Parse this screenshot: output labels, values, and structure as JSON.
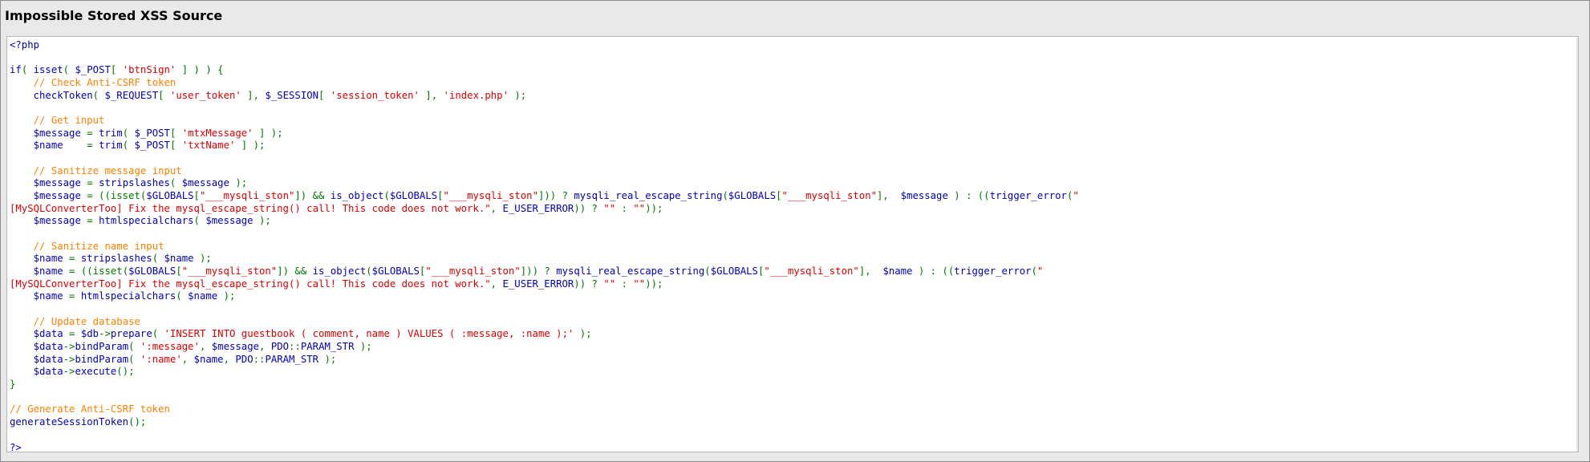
{
  "title": "Impossible Stored XSS Source",
  "code_lines": [
    [
      [
        "def",
        "<?php"
      ]
    ],
    [],
    [
      [
        "def",
        "if"
      ],
      [
        "kw",
        "( "
      ],
      [
        "def",
        "isset"
      ],
      [
        "kw",
        "( "
      ],
      [
        "def",
        "$_POST"
      ],
      [
        "kw",
        "[ "
      ],
      [
        "str",
        "'btnSign'"
      ],
      [
        "kw",
        " ] ) ) {"
      ]
    ],
    [
      [
        "kw",
        "    "
      ],
      [
        "com",
        "// Check Anti-CSRF token"
      ]
    ],
    [
      [
        "kw",
        "    "
      ],
      [
        "def",
        "checkToken"
      ],
      [
        "kw",
        "( "
      ],
      [
        "def",
        "$_REQUEST"
      ],
      [
        "kw",
        "[ "
      ],
      [
        "str",
        "'user_token'"
      ],
      [
        "kw",
        " ], "
      ],
      [
        "def",
        "$_SESSION"
      ],
      [
        "kw",
        "[ "
      ],
      [
        "str",
        "'session_token'"
      ],
      [
        "kw",
        " ], "
      ],
      [
        "str",
        "'index.php'"
      ],
      [
        "kw",
        " );"
      ]
    ],
    [],
    [
      [
        "kw",
        "    "
      ],
      [
        "com",
        "// Get input"
      ]
    ],
    [
      [
        "kw",
        "    "
      ],
      [
        "def",
        "$message"
      ],
      [
        "kw",
        " = "
      ],
      [
        "def",
        "trim"
      ],
      [
        "kw",
        "( "
      ],
      [
        "def",
        "$_POST"
      ],
      [
        "kw",
        "[ "
      ],
      [
        "str",
        "'mtxMessage'"
      ],
      [
        "kw",
        " ] );"
      ]
    ],
    [
      [
        "kw",
        "    "
      ],
      [
        "def",
        "$name"
      ],
      [
        "kw",
        "    = "
      ],
      [
        "def",
        "trim"
      ],
      [
        "kw",
        "( "
      ],
      [
        "def",
        "$_POST"
      ],
      [
        "kw",
        "[ "
      ],
      [
        "str",
        "'txtName'"
      ],
      [
        "kw",
        " ] );"
      ]
    ],
    [],
    [
      [
        "kw",
        "    "
      ],
      [
        "com",
        "// Sanitize message input"
      ]
    ],
    [
      [
        "kw",
        "    "
      ],
      [
        "def",
        "$message"
      ],
      [
        "kw",
        " = "
      ],
      [
        "def",
        "stripslashes"
      ],
      [
        "kw",
        "( "
      ],
      [
        "def",
        "$message"
      ],
      [
        "kw",
        " );"
      ]
    ],
    [
      [
        "kw",
        "    "
      ],
      [
        "def",
        "$message"
      ],
      [
        "kw",
        " = ((isset("
      ],
      [
        "def",
        "$GLOBALS"
      ],
      [
        "kw",
        "["
      ],
      [
        "str",
        "\"___mysqli_ston\""
      ],
      [
        "kw",
        "]) && "
      ],
      [
        "def",
        "is_object"
      ],
      [
        "kw",
        "("
      ],
      [
        "def",
        "$GLOBALS"
      ],
      [
        "kw",
        "["
      ],
      [
        "str",
        "\"___mysqli_ston\""
      ],
      [
        "kw",
        "])) ? "
      ],
      [
        "def",
        "mysqli_real_escape_string"
      ],
      [
        "kw",
        "("
      ],
      [
        "def",
        "$GLOBALS"
      ],
      [
        "kw",
        "["
      ],
      [
        "str",
        "\"___mysqli_ston\""
      ],
      [
        "kw",
        "],  "
      ],
      [
        "def",
        "$message"
      ],
      [
        "kw",
        " ) : (("
      ],
      [
        "def",
        "trigger_error"
      ],
      [
        "kw",
        "("
      ],
      [
        "str",
        "\""
      ]
    ],
    [
      [
        "str",
        "[MySQLConverterToo] Fix the mysql_escape_string() call! This code does not work.\""
      ],
      [
        "kw",
        ", "
      ],
      [
        "def",
        "E_USER_ERROR"
      ],
      [
        "kw",
        ")) ? "
      ],
      [
        "str",
        "\"\""
      ],
      [
        "kw",
        " : "
      ],
      [
        "str",
        "\"\""
      ],
      [
        "kw",
        "));"
      ]
    ],
    [
      [
        "kw",
        "    "
      ],
      [
        "def",
        "$message"
      ],
      [
        "kw",
        " = "
      ],
      [
        "def",
        "htmlspecialchars"
      ],
      [
        "kw",
        "( "
      ],
      [
        "def",
        "$message"
      ],
      [
        "kw",
        " );"
      ]
    ],
    [],
    [
      [
        "kw",
        "    "
      ],
      [
        "com",
        "// Sanitize name input"
      ]
    ],
    [
      [
        "kw",
        "    "
      ],
      [
        "def",
        "$name"
      ],
      [
        "kw",
        " = "
      ],
      [
        "def",
        "stripslashes"
      ],
      [
        "kw",
        "( "
      ],
      [
        "def",
        "$name"
      ],
      [
        "kw",
        " );"
      ]
    ],
    [
      [
        "kw",
        "    "
      ],
      [
        "def",
        "$name"
      ],
      [
        "kw",
        " = ((isset("
      ],
      [
        "def",
        "$GLOBALS"
      ],
      [
        "kw",
        "["
      ],
      [
        "str",
        "\"___mysqli_ston\""
      ],
      [
        "kw",
        "]) && "
      ],
      [
        "def",
        "is_object"
      ],
      [
        "kw",
        "("
      ],
      [
        "def",
        "$GLOBALS"
      ],
      [
        "kw",
        "["
      ],
      [
        "str",
        "\"___mysqli_ston\""
      ],
      [
        "kw",
        "])) ? "
      ],
      [
        "def",
        "mysqli_real_escape_string"
      ],
      [
        "kw",
        "("
      ],
      [
        "def",
        "$GLOBALS"
      ],
      [
        "kw",
        "["
      ],
      [
        "str",
        "\"___mysqli_ston\""
      ],
      [
        "kw",
        "],  "
      ],
      [
        "def",
        "$name"
      ],
      [
        "kw",
        " ) : (("
      ],
      [
        "def",
        "trigger_error"
      ],
      [
        "kw",
        "("
      ],
      [
        "str",
        "\""
      ]
    ],
    [
      [
        "str",
        "[MySQLConverterToo] Fix the mysql_escape_string() call! This code does not work.\""
      ],
      [
        "kw",
        ", "
      ],
      [
        "def",
        "E_USER_ERROR"
      ],
      [
        "kw",
        ")) ? "
      ],
      [
        "str",
        "\"\""
      ],
      [
        "kw",
        " : "
      ],
      [
        "str",
        "\"\""
      ],
      [
        "kw",
        "));"
      ]
    ],
    [
      [
        "kw",
        "    "
      ],
      [
        "def",
        "$name"
      ],
      [
        "kw",
        " = "
      ],
      [
        "def",
        "htmlspecialchars"
      ],
      [
        "kw",
        "( "
      ],
      [
        "def",
        "$name"
      ],
      [
        "kw",
        " );"
      ]
    ],
    [],
    [
      [
        "kw",
        "    "
      ],
      [
        "com",
        "// Update database"
      ]
    ],
    [
      [
        "kw",
        "    "
      ],
      [
        "def",
        "$data"
      ],
      [
        "kw",
        " = "
      ],
      [
        "def",
        "$db"
      ],
      [
        "kw",
        "->"
      ],
      [
        "def",
        "prepare"
      ],
      [
        "kw",
        "( "
      ],
      [
        "str",
        "'INSERT INTO guestbook ( comment, name ) VALUES ( :message, :name );'"
      ],
      [
        "kw",
        " );"
      ]
    ],
    [
      [
        "kw",
        "    "
      ],
      [
        "def",
        "$data"
      ],
      [
        "kw",
        "->"
      ],
      [
        "def",
        "bindParam"
      ],
      [
        "kw",
        "( "
      ],
      [
        "str",
        "':message'"
      ],
      [
        "kw",
        ", "
      ],
      [
        "def",
        "$message"
      ],
      [
        "kw",
        ", "
      ],
      [
        "def",
        "PDO"
      ],
      [
        "kw",
        "::"
      ],
      [
        "def",
        "PARAM_STR"
      ],
      [
        "kw",
        " );"
      ]
    ],
    [
      [
        "kw",
        "    "
      ],
      [
        "def",
        "$data"
      ],
      [
        "kw",
        "->"
      ],
      [
        "def",
        "bindParam"
      ],
      [
        "kw",
        "( "
      ],
      [
        "str",
        "':name'"
      ],
      [
        "kw",
        ", "
      ],
      [
        "def",
        "$name"
      ],
      [
        "kw",
        ", "
      ],
      [
        "def",
        "PDO"
      ],
      [
        "kw",
        "::"
      ],
      [
        "def",
        "PARAM_STR"
      ],
      [
        "kw",
        " );"
      ]
    ],
    [
      [
        "kw",
        "    "
      ],
      [
        "def",
        "$data"
      ],
      [
        "kw",
        "->"
      ],
      [
        "def",
        "execute"
      ],
      [
        "kw",
        "();"
      ]
    ],
    [
      [
        "kw",
        "}"
      ]
    ],
    [],
    [
      [
        "com",
        "// Generate Anti-CSRF token"
      ]
    ],
    [
      [
        "def",
        "generateSessionToken"
      ],
      [
        "kw",
        "();"
      ]
    ],
    [],
    [
      [
        "def",
        "?>"
      ]
    ]
  ]
}
